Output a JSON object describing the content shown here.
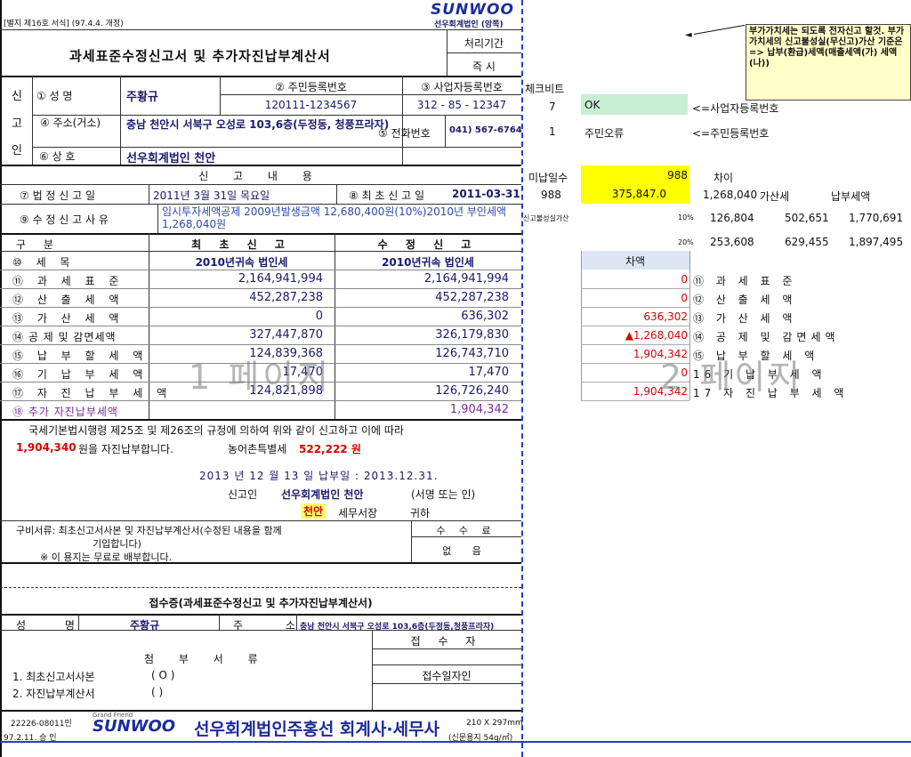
{
  "header": {
    "form_no": "[별지 제16호 서식] (97.4.4. 개정)",
    "logo_text": "SUNWOO",
    "firm_label": "선우회계법인 (암쪽)",
    "title": "과세표준수정신고서 및 추가자진납부계산서",
    "processing_label": "처리기간",
    "processing_value": "즉 시"
  },
  "reporter": {
    "side_label": [
      "신",
      "고",
      "인"
    ],
    "name_label": "① 성 명",
    "name_value": "주황규",
    "rrn_label": "② 주민등록번호",
    "rrn_value": "120111-1234567",
    "brn_label": "③ 사업자등록번호",
    "brn_value": "312 - 85 - 12347",
    "addr_label": "④ 주소(거소)",
    "addr_value": "충남 천안시 서북구 오성로 103,6층(두정동, 청풍프라자)",
    "phone_label": "⑤ 전화번호",
    "phone_value": "041) 567-6764",
    "trade_label": "⑥ 상 호",
    "trade_value": "선우회계법인 천안"
  },
  "report": {
    "section_title": "신 고 내 용",
    "legal_date_label": "⑦ 법 정 신 고 일",
    "legal_date_value": "2011년 3월 31일 목요일",
    "first_date_label": "⑧ 최 초 신 고 일",
    "first_date_value": "2011-03-31",
    "reason_label": "⑨ 수 정 신 고 사 유",
    "reason_value": "임시투자세액공제 2009년발생금액 12,680,400원(10%)2010년 부인세액 1,268,040원"
  },
  "table": {
    "col_item": "구 분",
    "col_first": "최 초 신 고",
    "col_revised": "수 정 신 고",
    "rows": [
      {
        "label": "⑩ 세 목",
        "first": "2010년귀속 법인세",
        "revised": "2010년귀속 법인세"
      },
      {
        "label": "⑪ 과 세 표 준",
        "first": "2,164,941,994",
        "revised": "2,164,941,994"
      },
      {
        "label": "⑫ 산 출 세 액",
        "first": "452,287,238",
        "revised": "452,287,238"
      },
      {
        "label": "⑬ 가 산 세 액",
        "first": "0",
        "revised": "636,302"
      },
      {
        "label": "⑭ 공 제 및 감면세액",
        "first": "327,447,870",
        "revised": "326,179,830"
      },
      {
        "label": "⑮ 납 부 할 세 액",
        "first": "124,839,368",
        "revised": "126,743,710"
      },
      {
        "label": "⑯ 기 납 부 세 액",
        "first": "17,470",
        "revised": "17,470"
      },
      {
        "label": "⑰ 자 진 납 부 세 액",
        "first": "124,821,898",
        "revised": "126,726,240"
      },
      {
        "label": "⑱ 추가 자진납부세액",
        "first": "",
        "revised": "1,904,342"
      }
    ],
    "watermark_page1": "1 페이지"
  },
  "declaration": {
    "line1": "국세기본법시행령 제25조 및 제26조의 규정에 의하여 위와 같이 신고하고 이에 따라",
    "amount": "1,904,340",
    "line2a": "원을 자진납부합니다.",
    "rural_label": "농어촌특별세",
    "rural_amount": "522,222 원",
    "date_line": "2013 년 12 월 13 일 납부일 : 2013.12.31.",
    "signer_label": "신고인",
    "signer_value": "선우회계법인 천안",
    "sign_note": "(서명 또는 인)",
    "office_name": "천안",
    "office_label": "세무서장",
    "office_suffix": "귀하"
  },
  "attach": {
    "docs_line1": "구비서류: 최초신고서사본 및 자진납부계산서(수정된 내용을 함께",
    "docs_line2": "기입합니다)",
    "free_note": "※ 이 용지는 무료로 배부합니다.",
    "fee_label": "수 수 료",
    "fee_value": "없 음"
  },
  "receipt": {
    "title": "접수증(과세표준수정신고 및 추가자진납부계산서)",
    "name_label": "성 명",
    "name_value": "주황규",
    "addr_label": "주 소",
    "addr_value": "충남 천안시 서북구 오성로 103,6층(두정동,청풍프라자)",
    "receiver_label": "접 수 자",
    "attach_label": "첨 부 서 류",
    "date_label": "접수일자인",
    "item1": "1. 최초신고서사본",
    "item1_mark": "( O )",
    "item2": "2. 자진납부계산서",
    "item2_mark": "( )"
  },
  "footer": {
    "code": "22226-08011민",
    "approve": "97.2.11. 승 인",
    "small_logo_text": "Grand Friend",
    "brand": "선우회계법인주홍선 회계사·세무사",
    "paper_size": "210 X 297mm",
    "paper_note": "(신문용지 54g/㎡)"
  },
  "side": {
    "note": "부가가치세는 되도록 전자신고 할것. 부가가치세의 신고불성실(무신고)가산 기준은 => 납부(환급)세액(매출세액(가) 세액(나))",
    "check_title": "체크비트",
    "check_row1_num": "7",
    "check_row1_ok": "OK",
    "check_row1_note": "<=사업자등록번호",
    "check_row2_num": "1",
    "check_row2_val": "주민오류",
    "check_row2_note": "<=주민등록번호",
    "unpaid_days_label": "미납일수",
    "unpaid_days_value": "988",
    "diff_label": "차이",
    "days_value": "988",
    "calc_value": "375,847.0",
    "diff_value": "1,268,040",
    "add_tax_label": "가산세",
    "pay_label": "납부세액",
    "row10_label": "신고불성실가산",
    "row10_rate": "10%",
    "row10_a": "126,804",
    "row10_b": "502,651",
    "row10_c": "1,770,691",
    "row20_rate": "20%",
    "row20_a": "253,608",
    "row20_b": "629,455",
    "row20_c": "1,897,495",
    "diff_header": "차액",
    "diff_rows": [
      {
        "value": "0",
        "label": "⑪ 과 세 표 준"
      },
      {
        "value": "0",
        "label": "⑫ 산 출 세 액"
      },
      {
        "value": "636,302",
        "label": "⑬ 가 산 세 액"
      },
      {
        "value": "▲1,268,040",
        "label": "⑭ 공 제 및 감면세액"
      },
      {
        "value": "1,904,342",
        "label": "⑮ 납 부 할 세 액"
      },
      {
        "value": "0",
        "label": "16 기 납 부 세 액"
      },
      {
        "value": "1,904,342",
        "label": "17 자 진 납 부 세 액"
      }
    ],
    "watermark_page2": "2 페이지"
  }
}
